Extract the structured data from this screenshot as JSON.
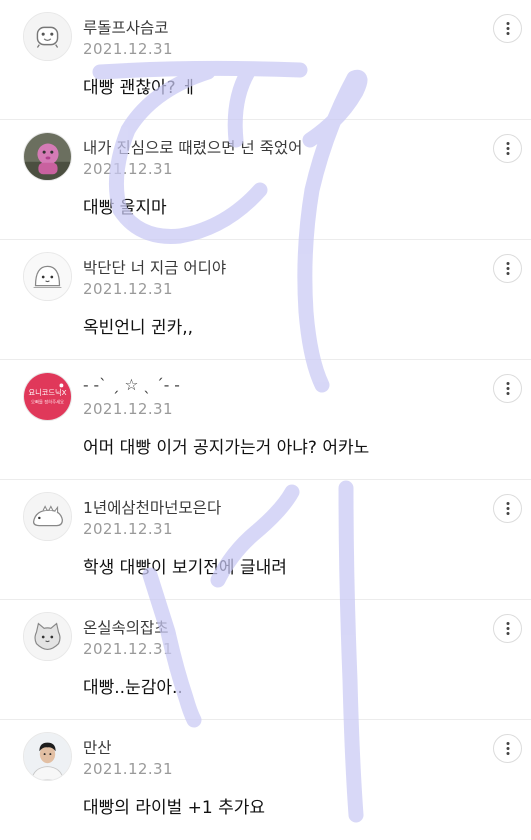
{
  "comments": [
    {
      "nickname": "루돌프사슴코",
      "date": "2021.12.31",
      "text": "대빵 괜찮아? ㅔ",
      "avatar_icon": "character-mascot-icon",
      "more_icon": "more-vertical-icon"
    },
    {
      "nickname": "내가 진심으로 때렸으면 넌 죽었어",
      "date": "2021.12.31",
      "text": "대빵 울지마",
      "avatar_icon": "photo-avatar-icon",
      "more_icon": "more-vertical-icon"
    },
    {
      "nickname": "박단단 너 지금 어디야",
      "date": "2021.12.31",
      "text": "옥빈언니 귄카,,",
      "avatar_icon": "cute-face-icon",
      "more_icon": "more-vertical-icon"
    },
    {
      "nickname": "- -` ˏ ☆ ˎ ´- -",
      "date": "2021.12.31",
      "text": "어머 대빵 이거 공지가는거 아냐? 어카노",
      "avatar_icon": "pink-badge-icon",
      "more_icon": "more-vertical-icon"
    },
    {
      "nickname": "1년에삼천마넌모은다",
      "date": "2021.12.31",
      "text": "학생 대빵이 보기전에 글내려",
      "avatar_icon": "dinosaur-icon",
      "more_icon": "more-vertical-icon"
    },
    {
      "nickname": "온실속의잡초",
      "date": "2021.12.31",
      "text": "대빵..눈감아..",
      "avatar_icon": "cat-icon",
      "more_icon": "more-vertical-icon"
    },
    {
      "nickname": "만산",
      "date": "2021.12.31",
      "text": "대빵의 라이벌 +1 추가요",
      "avatar_icon": "person-photo-icon",
      "more_icon": "more-vertical-icon"
    }
  ],
  "badge": {
    "line1": "요니코드닉X",
    "line2": "오빠를 정하주세요"
  },
  "colors": {
    "overlay_stroke": "#c9c9f4",
    "badge_bg": "#e0385a",
    "date": "#9a9a9a"
  }
}
